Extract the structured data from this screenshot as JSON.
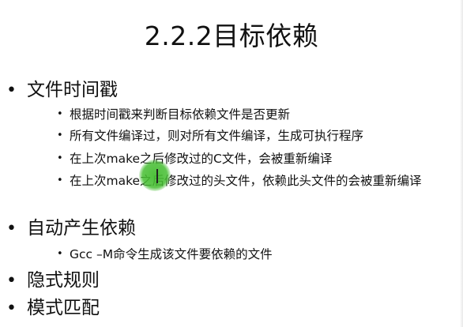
{
  "title": "2.2.2目标依赖",
  "sections": [
    {
      "label": "文件时间戳",
      "items": [
        "根据时间戳来判断目标依赖文件是否更新",
        "所有文件编译过，则对所有文件编译，生成可执行程序",
        "在上次make之后修改过的C文件，会被重新编译",
        "在上次make之后修改过的头文件，依赖此头文件的会被重新编译"
      ]
    },
    {
      "label": "自动产生依赖",
      "items": [
        "Gcc –M命令生成该文件要依赖的文件"
      ]
    },
    {
      "label": "隐式规则",
      "items": []
    },
    {
      "label": "模式匹配",
      "items": []
    }
  ],
  "bullet_l1": "•",
  "bullet_l2": "•"
}
